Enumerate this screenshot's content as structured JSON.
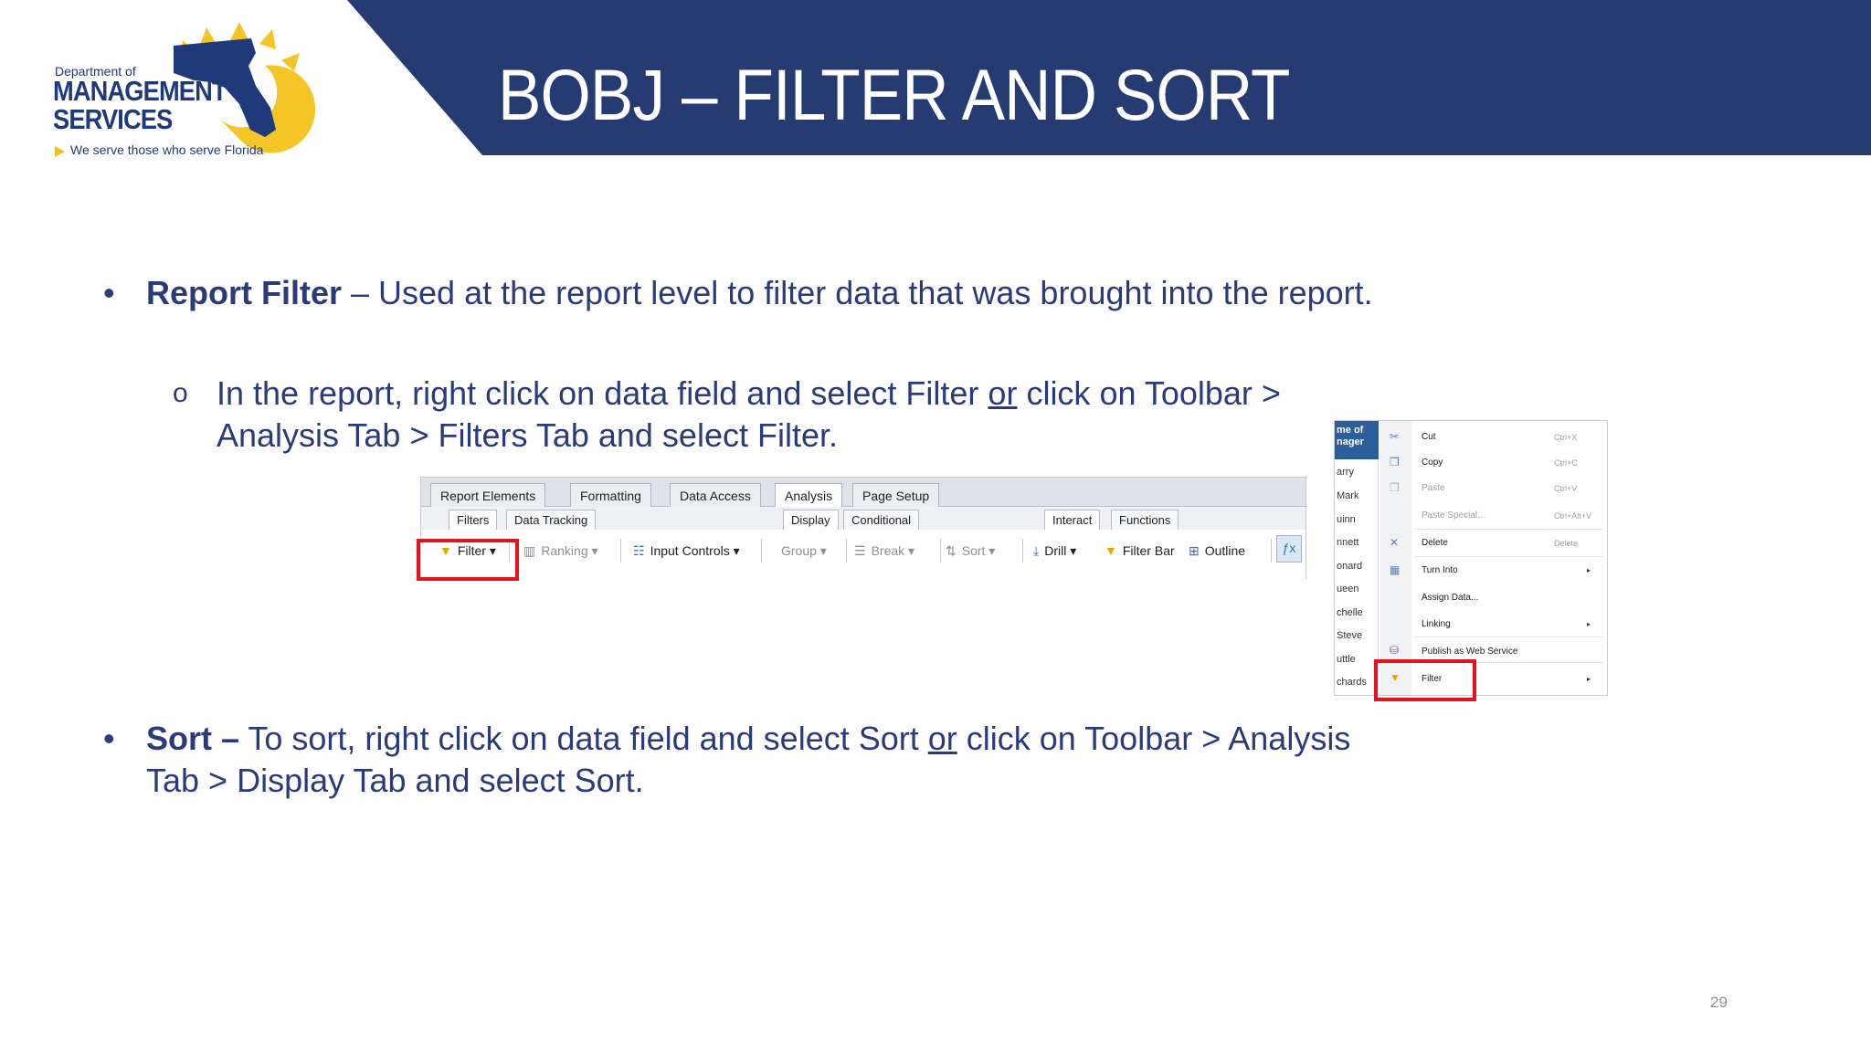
{
  "header": {
    "title": "BOBJ – FILTER AND SORT",
    "band_color": "#253b72"
  },
  "logo": {
    "dept_line": "Department of",
    "mgmt_line": "MANAGEMENT",
    "services_line": "SERVICES",
    "tagline": "We serve those who serve Florida",
    "sun_color": "#f4c526",
    "state_color": "#1f3a7a"
  },
  "bullets": {
    "report_filter": {
      "term": "Report Filter",
      "text": " – Used at the report level to filter data that was brought into the report."
    },
    "sub": {
      "marker": "o",
      "part1": "In the report, right click on data field and select Filter ",
      "or": "or",
      "part2": " click on Toolbar >",
      "line2": "Analysis Tab > Filters Tab and select Filter."
    },
    "sort": {
      "term": "Sort –",
      "part1": " To sort, right click on data field and select Sort ",
      "or": "or",
      "part2": " click on Toolbar > Analysis",
      "line2": "Tab > Display Tab and select Sort."
    },
    "marker": "•"
  },
  "toolbar": {
    "tabs": [
      "Report Elements",
      "Formatting",
      "Data Access",
      "Analysis",
      "Page Setup"
    ],
    "active_tab": "Analysis",
    "subtabs": [
      "Filters",
      "Data Tracking",
      "Display",
      "Conditional",
      "Interact",
      "Functions"
    ],
    "buttons": {
      "filter": "Filter",
      "ranking": "Ranking",
      "input_controls": "Input Controls",
      "group": "Group",
      "break": "Break",
      "sort": "Sort",
      "drill": "Drill",
      "filter_bar": "Filter Bar",
      "outline": "Outline"
    },
    "highlight_color": "#e3141b"
  },
  "context_menu": {
    "column_header": "me of nager",
    "names": [
      "arry",
      "Mark",
      "uinn",
      "nnett",
      "onard",
      "ueen",
      "chelle",
      "Steve",
      "uttle",
      "chards"
    ],
    "items": [
      {
        "label": "Cut",
        "shortcut": "Ctrl+X"
      },
      {
        "label": "Copy",
        "shortcut": "Ctrl+C"
      },
      {
        "label": "Paste",
        "shortcut": "Ctrl+V"
      },
      {
        "label": "Paste Special...",
        "shortcut": "Ctrl+Alt+V"
      },
      {
        "label": "Delete",
        "shortcut": "Delete"
      },
      {
        "label": "Turn Into",
        "shortcut": ""
      },
      {
        "label": "Assign Data...",
        "shortcut": ""
      },
      {
        "label": "Linking",
        "shortcut": ""
      },
      {
        "label": "Publish as Web Service",
        "shortcut": ""
      },
      {
        "label": "Filter",
        "shortcut": ""
      }
    ]
  },
  "page_number": "29"
}
